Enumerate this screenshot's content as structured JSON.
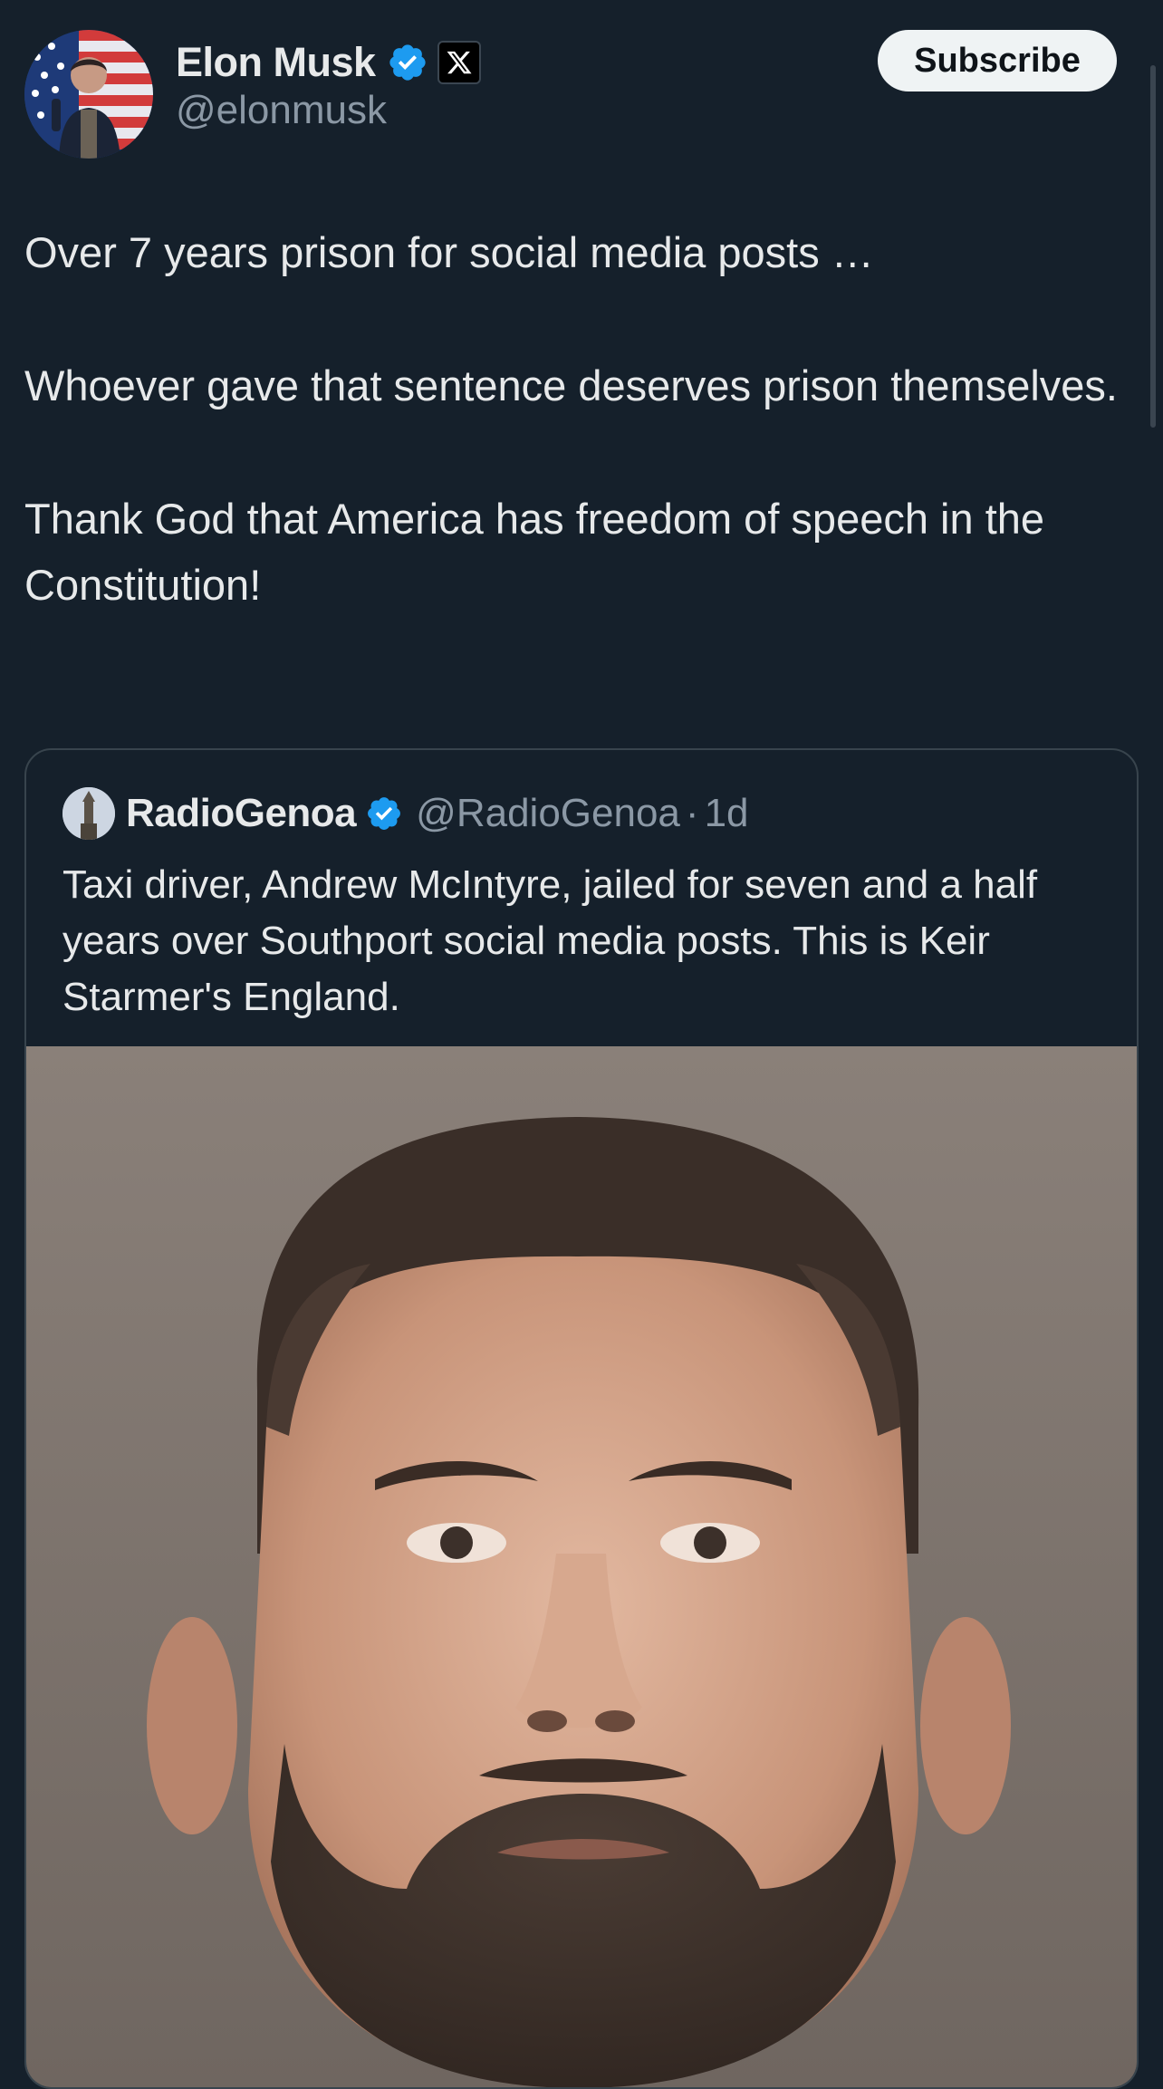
{
  "author": {
    "display_name": "Elon Musk",
    "handle": "@elonmusk",
    "avatar_icon": "profile-photo-icon",
    "verified_icon": "verified-badge-icon",
    "affiliate_icon": "x-logo-icon"
  },
  "subscribe_label": "Subscribe",
  "tweet": {
    "paragraphs": [
      "Over 7 years prison for social media posts …",
      "Whoever gave that sentence deserves prison themselves.",
      "Thank God that America has freedom of speech in the Constitution!"
    ]
  },
  "quoted_tweet": {
    "display_name": "RadioGenoa",
    "handle": "@RadioGenoa",
    "separator": "·",
    "time": "1d",
    "text": "Taxi driver, Andrew McIntyre, jailed for seven and a half years over Southport social media posts. This is Keir Starmer's England.",
    "media_icon": "photo-portrait-icon"
  },
  "colors": {
    "background": "#15202b",
    "text_primary": "#e7e9ea",
    "text_secondary": "#8b98a5",
    "verified_blue": "#1d9bf0",
    "border": "#38444d",
    "subscribe_bg": "#eff3f4"
  }
}
